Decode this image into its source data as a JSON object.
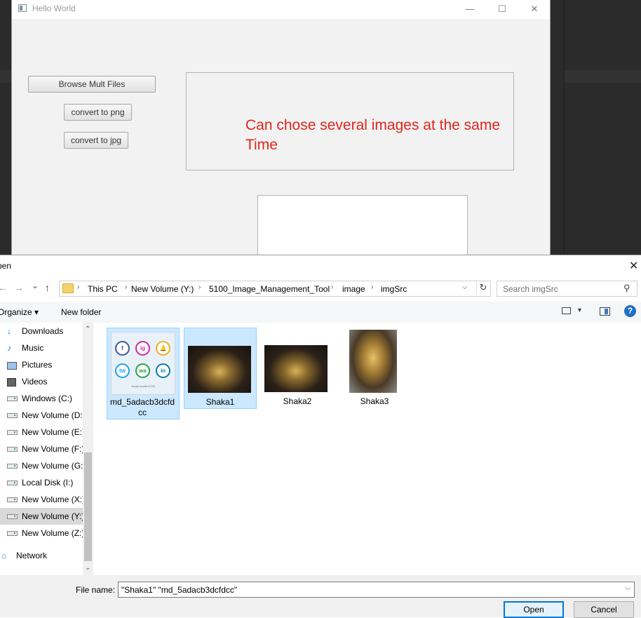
{
  "app_window": {
    "title": "Hello World",
    "controls": {
      "minimize": "—",
      "maximize": "☐",
      "close": "✕"
    },
    "buttons": {
      "browse": "Browse Mult Files",
      "to_png": "convert to png",
      "to_jpg": "convert to jpg"
    },
    "annotation": "Can chose several images at the same Time"
  },
  "dialog": {
    "title": "Open",
    "title_visible": "pen",
    "close": "✕",
    "nav": {
      "back": "←",
      "forward": "→",
      "dropdown": "⌄",
      "up": "↑"
    },
    "breadcrumb": [
      "This PC",
      "New Volume (Y:)",
      "5100_Image_Management_Tool",
      "image",
      "imgSrc"
    ],
    "search_placeholder": "Search imgSrc",
    "toolbar": {
      "organize": "Organize ▾",
      "new_folder": "New folder",
      "help": "?"
    },
    "sidebar": [
      {
        "label": "Downloads",
        "icon": "download-icon"
      },
      {
        "label": "Music",
        "icon": "music-icon"
      },
      {
        "label": "Pictures",
        "icon": "pictures-icon"
      },
      {
        "label": "Videos",
        "icon": "videos-icon"
      },
      {
        "label": "Windows (C:)",
        "icon": "windows-drive-icon"
      },
      {
        "label": "New Volume (D:)",
        "icon": "drive-icon"
      },
      {
        "label": "New Volume (E:)",
        "icon": "drive-icon"
      },
      {
        "label": "New Volume (F:)",
        "icon": "drive-icon"
      },
      {
        "label": "New Volume (G:)",
        "icon": "drive-icon"
      },
      {
        "label": "Local Disk (I:)",
        "icon": "drive-icon"
      },
      {
        "label": "New Volume (X:)",
        "icon": "drive-icon"
      },
      {
        "label": "New Volume (Y:)",
        "icon": "drive-icon",
        "selected": true
      },
      {
        "label": "New Volume (Z:)",
        "icon": "drive-icon"
      }
    ],
    "network": "Network",
    "files": [
      {
        "name": "md_5adacb3dcfdcc",
        "selected": true
      },
      {
        "name": "Shaka1",
        "selected": true
      },
      {
        "name": "Shaka2",
        "selected": false
      },
      {
        "name": "Shaka3",
        "selected": false
      }
    ],
    "social_thumb": {
      "icons": [
        "f",
        "ig",
        "🔔",
        "tw",
        "wa",
        "in"
      ],
      "caption": "Social media ICON"
    },
    "file_name_label": "File name:",
    "file_name_value": "\"Shaka1\" \"md_5adacb3dcfdcc\"",
    "open_label": "Open",
    "cancel_label": "Cancel"
  },
  "colors": {
    "annotation": "#e0251e",
    "selection": "#cce8ff",
    "accent": "#0078d7"
  }
}
